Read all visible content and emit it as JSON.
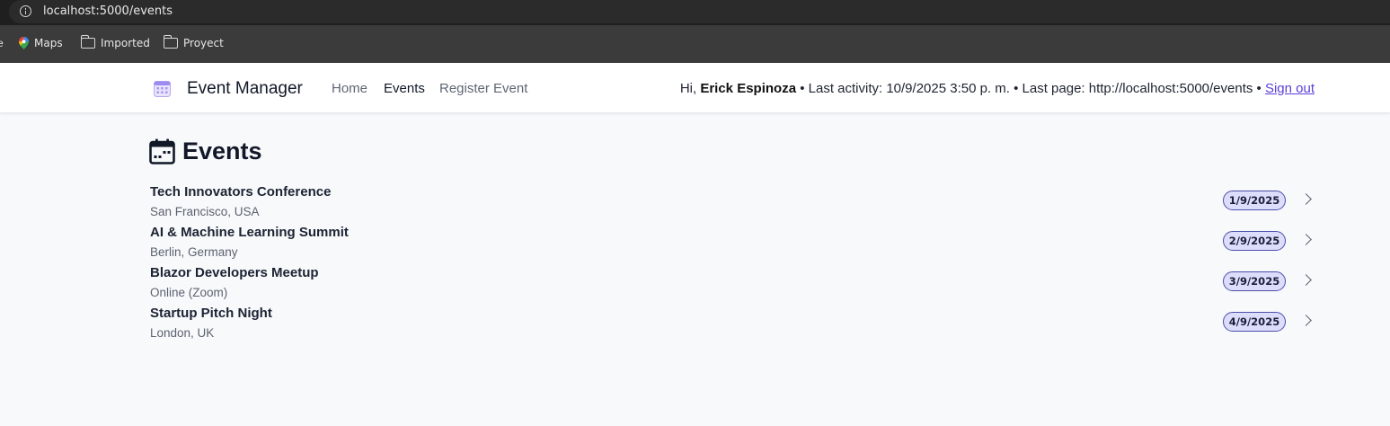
{
  "browser": {
    "url": "localhost:5000/events",
    "bookmarks": [
      {
        "label": "e",
        "icon": "truncated"
      },
      {
        "label": "Maps",
        "icon": "maps-pin-icon"
      },
      {
        "label": "Imported",
        "icon": "folder-icon"
      },
      {
        "label": "Proyect",
        "icon": "folder-icon"
      }
    ]
  },
  "header": {
    "brand": "Event Manager",
    "nav": [
      "Home",
      "Events",
      "Register Event"
    ],
    "active_nav": "Events",
    "greeting": "Hi, ",
    "user_name": "Erick Espinoza",
    "activity_text": " • Last activity: 10/9/2025 3:50 p. m. • Last page: http://localhost:5000/events • ",
    "signout": "Sign out"
  },
  "main": {
    "title": "Events",
    "events": [
      {
        "name": "Tech Innovators Conference",
        "location": "San Francisco, USA",
        "date": "1/9/2025"
      },
      {
        "name": "AI & Machine Learning Summit",
        "location": "Berlin, Germany",
        "date": "2/9/2025"
      },
      {
        "name": "Blazor Developers Meetup",
        "location": "Online (Zoom)",
        "date": "3/9/2025"
      },
      {
        "name": "Startup Pitch Night",
        "location": "London, UK",
        "date": "4/9/2025"
      }
    ]
  },
  "colors": {
    "accent": "#5b3fd6",
    "badge_bg": "#dcdcfb",
    "badge_border": "#4b4fa8"
  }
}
